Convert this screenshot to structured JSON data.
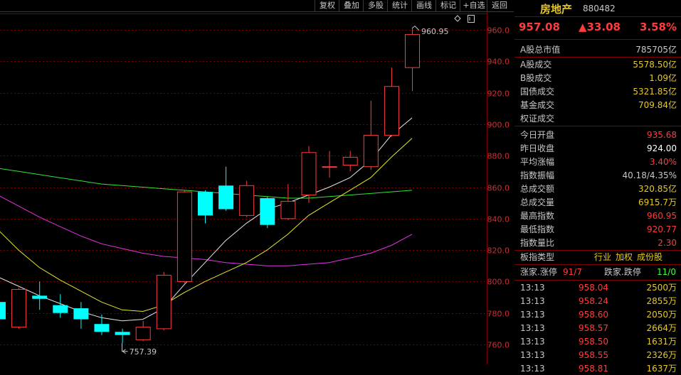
{
  "toolbar": {
    "buttons": [
      "复权",
      "叠加",
      "多股",
      "统计",
      "画线",
      "标记",
      "+自选",
      "返回"
    ]
  },
  "chart_data": {
    "type": "candlestick",
    "y_ticks": [
      "960.0",
      "940.0",
      "920.0",
      "900.0",
      "880.0",
      "860.0",
      "840.0",
      "820.0",
      "800.0",
      "780.0",
      "760.0"
    ],
    "ylim": [
      752,
      968
    ],
    "candles": [
      {
        "o": 787,
        "h": 788,
        "l": 775,
        "c": 776
      },
      {
        "o": 771,
        "h": 796,
        "l": 770,
        "c": 795
      },
      {
        "o": 791,
        "h": 800,
        "l": 782,
        "c": 789
      },
      {
        "o": 785,
        "h": 792,
        "l": 777,
        "c": 780
      },
      {
        "o": 783,
        "h": 787,
        "l": 770,
        "c": 776
      },
      {
        "o": 773,
        "h": 779,
        "l": 766,
        "c": 768
      },
      {
        "o": 768,
        "h": 770,
        "l": 761,
        "c": 766
      },
      {
        "o": 763,
        "h": 775,
        "l": 762,
        "c": 771
      },
      {
        "o": 770,
        "h": 806,
        "l": 769,
        "c": 804
      },
      {
        "o": 800,
        "h": 858,
        "l": 799,
        "c": 857
      },
      {
        "o": 857,
        "h": 858,
        "l": 837,
        "c": 842
      },
      {
        "o": 861,
        "h": 873,
        "l": 845,
        "c": 846
      },
      {
        "o": 842,
        "h": 864,
        "l": 841,
        "c": 861
      },
      {
        "o": 853,
        "h": 854,
        "l": 834,
        "c": 836
      },
      {
        "o": 840,
        "h": 862,
        "l": 839,
        "c": 851
      },
      {
        "o": 855,
        "h": 886,
        "l": 850,
        "c": 882
      },
      {
        "o": 873,
        "h": 883,
        "l": 866,
        "c": 873
      },
      {
        "o": 874,
        "h": 883,
        "l": 870,
        "c": 879
      },
      {
        "o": 873,
        "h": 915,
        "l": 871,
        "c": 893
      },
      {
        "o": 893,
        "h": 936,
        "l": 892,
        "c": 924
      },
      {
        "o": 936,
        "h": 961,
        "l": 921,
        "c": 957
      }
    ],
    "ma_white": [
      803,
      797,
      791,
      786,
      781,
      777,
      775,
      776,
      783,
      798,
      812,
      826,
      837,
      846,
      850,
      855,
      860,
      866,
      877,
      893,
      904
    ],
    "ma_yellow": [
      833,
      820,
      809,
      801,
      794,
      787,
      782,
      781,
      785,
      793,
      800,
      806,
      812,
      820,
      830,
      842,
      850,
      858,
      866,
      879,
      891
    ],
    "ma_green": [
      872,
      870,
      868,
      866,
      864,
      862,
      861,
      860,
      859,
      858,
      857,
      856,
      855,
      854,
      853,
      853,
      854,
      855,
      856,
      857,
      858
    ],
    "ma_magenta": [
      855,
      848,
      841,
      835,
      829,
      824,
      821,
      818,
      816,
      815,
      814,
      812,
      811,
      810,
      810,
      811,
      812,
      815,
      818,
      823,
      830
    ],
    "annotations": {
      "high": "960.95",
      "low": "757.39"
    }
  },
  "panel": {
    "title": "房地产",
    "code": "880482",
    "price": "957.08",
    "change": "▲33.08",
    "pct": "3.58%",
    "stats": [
      {
        "label": "A股总市值",
        "value": "785705亿",
        "cls": "gry"
      },
      {
        "label": "A股成交",
        "value": "5578.50亿",
        "cls": "yel"
      },
      {
        "label": "B股成交",
        "value": "1.09亿",
        "cls": "yel"
      },
      {
        "label": "国债成交",
        "value": "5321.85亿",
        "cls": "yel"
      },
      {
        "label": "基金成交",
        "value": "709.84亿",
        "cls": "yel"
      },
      {
        "label": "权证成交",
        "value": "",
        "cls": "yel"
      },
      {
        "label": "今日开盘",
        "value": "935.68",
        "cls": "red"
      },
      {
        "label": "昨日收盘",
        "value": "924.00",
        "cls": "wht"
      },
      {
        "label": "平均涨幅",
        "value": "3.40%",
        "cls": "red"
      },
      {
        "label": "指数振幅",
        "value": "40.18/4.35%",
        "cls": "gry"
      },
      {
        "label": "总成交额",
        "value": "320.85亿",
        "cls": "yel"
      },
      {
        "label": "总成交量",
        "value": "6915.7万",
        "cls": "yel"
      },
      {
        "label": "最高指数",
        "value": "960.95",
        "cls": "red"
      },
      {
        "label": "最低指数",
        "value": "920.77",
        "cls": "red"
      },
      {
        "label": "指数量比",
        "value": "2.30",
        "cls": "red"
      }
    ],
    "board_type_label": "板指类型",
    "board_types": [
      "行业",
      "加权",
      "成份股"
    ],
    "advance_label": "涨家.涨停",
    "advance_value": "91/7",
    "decline_label": "跌家.跌停",
    "decline_value": "11/0",
    "ticks": [
      {
        "time": "13:13",
        "price": "958.04",
        "vol": "2500万"
      },
      {
        "time": "13:13",
        "price": "958.24",
        "vol": "2855万"
      },
      {
        "time": "13:13",
        "price": "958.60",
        "vol": "2050万"
      },
      {
        "time": "13:13",
        "price": "958.57",
        "vol": "2664万"
      },
      {
        "time": "13:13",
        "price": "958.50",
        "vol": "1631万"
      },
      {
        "time": "13:13",
        "price": "958.55",
        "vol": "2326万"
      },
      {
        "time": "13:13",
        "price": "958.81",
        "vol": "1637万"
      }
    ],
    "colors": {
      "up": "#ff3c3c",
      "down": "#00ffff",
      "border": "#800000"
    }
  }
}
